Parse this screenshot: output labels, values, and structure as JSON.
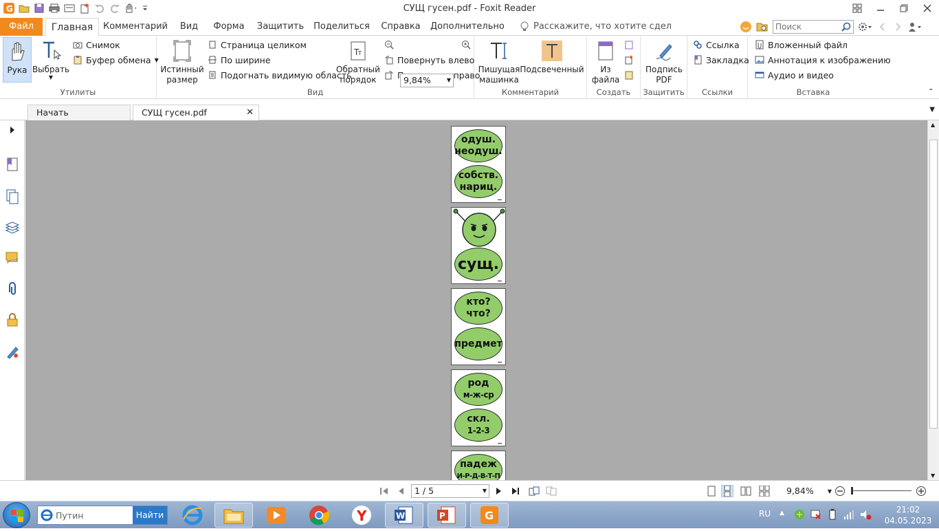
{
  "window": {
    "title": "СУЩ  гусен.pdf - Foxit Reader"
  },
  "quick_access": [
    "open-icon",
    "save-icon",
    "print-icon",
    "undo-icon",
    "redo-icon",
    "hand-dropdown-icon"
  ],
  "ribbon_tabs": {
    "file": "Файл",
    "home": "Главная",
    "comment": "Комментарий",
    "view": "Вид",
    "form": "Форма",
    "protect": "Защитить",
    "share": "Поделиться",
    "help": "Справка",
    "extra": "Дополнительно",
    "tellme": "Расскажите, что хотите сдел"
  },
  "search": {
    "placeholder": "Поиск"
  },
  "ribbon": {
    "utilities": {
      "label": "Утилиты",
      "hand": "Рука",
      "select": "Выбрать",
      "snapshot": "Снимок",
      "clipboard": "Буфер обмена"
    },
    "view": {
      "label": "Вид",
      "actual_size_1": "Истинный",
      "actual_size_2": "размер",
      "fit_page": "Страница целиком",
      "fit_width": "По ширине",
      "fit_visible": "Подогнать видимую область",
      "reverse_1": "Обратный",
      "reverse_2": "порядок",
      "zoom": "9,84%",
      "rotate_left": "Повернуть влево",
      "rotate_right": "Повернуть вправо"
    },
    "comment": {
      "label": "Комментарий",
      "typewriter_1": "Пишущая",
      "typewriter_2": "машинка",
      "highlight": "Подсвеченный"
    },
    "create": {
      "label": "Создать",
      "from_file_1": "Из",
      "from_file_2": "файла"
    },
    "protect": {
      "label": "Защитить",
      "sign_1": "Подпись",
      "sign_2": "PDF"
    },
    "links": {
      "label": "Ссылки",
      "link": "Ссылка",
      "bookmark": "Закладка"
    },
    "insert": {
      "label": "Вставка",
      "attachment": "Вложенный файл",
      "image_annot": "Аннотация к изображению",
      "audio_video": "Аудио и видео"
    }
  },
  "doc_tabs": {
    "start": "Начать",
    "current": "СУЩ  гусен.pdf"
  },
  "pages": [
    {
      "top": "одуш.",
      "top2": "неодуш.",
      "bottom": "собств.",
      "bottom2": "нариц."
    },
    {
      "bottom": "сущ."
    },
    {
      "top": "кто?",
      "top2": "что?",
      "bottom": "предмет"
    },
    {
      "top": "род",
      "top2": "м-ж-ср",
      "bottom": "скл.",
      "bottom2": "1-2-3"
    },
    {
      "top": "падеж",
      "top2": "И-Р-Д-В-Т-П"
    }
  ],
  "status": {
    "page": "1 / 5",
    "zoom": "9,84%"
  },
  "taskbar": {
    "search_placeholder": "Путин",
    "search_go": "Найти",
    "lang": "RU",
    "time": "21:02",
    "date": "04.05.2023"
  },
  "colors": {
    "file_tab": "#f08a1c",
    "oval_fill": "#92cd6a",
    "doc_background": "#ababab"
  }
}
